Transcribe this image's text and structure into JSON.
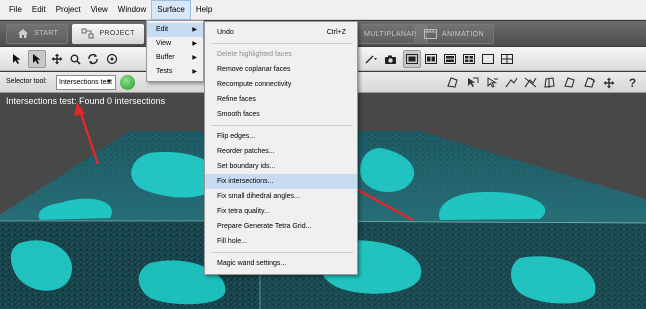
{
  "menubar": {
    "items": [
      "File",
      "Edit",
      "Project",
      "View",
      "Window",
      "Surface",
      "Help"
    ],
    "active_index": 5
  },
  "tabs": {
    "start": "START",
    "project": "PROJECT",
    "multiplanar": "MULTIPLANAR",
    "animation": "ANIMATION"
  },
  "selector": {
    "label": "Selector tool:",
    "value": "Intersections test"
  },
  "viewport": {
    "status": "Intersections test: Found 0 intersections",
    "mesh_color": "#1fd4cf",
    "arrow_color": "#e0282d"
  },
  "surface_menu": {
    "items": [
      {
        "label": "Edit",
        "submenu": true
      },
      {
        "label": "View",
        "submenu": true
      },
      {
        "label": "Buffer",
        "submenu": true
      },
      {
        "label": "Tests",
        "submenu": true
      }
    ]
  },
  "edit_menu": {
    "undo": {
      "label": "Undo",
      "shortcut": "Ctrl+Z"
    },
    "group1": [
      "Delete highlighted faces",
      "Remove coplanar faces",
      "Recompute connectivity",
      "Refine faces",
      "Smooth faces"
    ],
    "group2": [
      "Flip edges...",
      "Reorder patches...",
      "Set boundary ids...",
      "Fix intersections...",
      "Fix small dihedral angles...",
      "Fix tetra quality...",
      "Prepare Generate Tetra Grid...",
      "Fill hole..."
    ],
    "group3": [
      "Magic wand settings..."
    ],
    "highlighted": "Fix intersections..."
  }
}
